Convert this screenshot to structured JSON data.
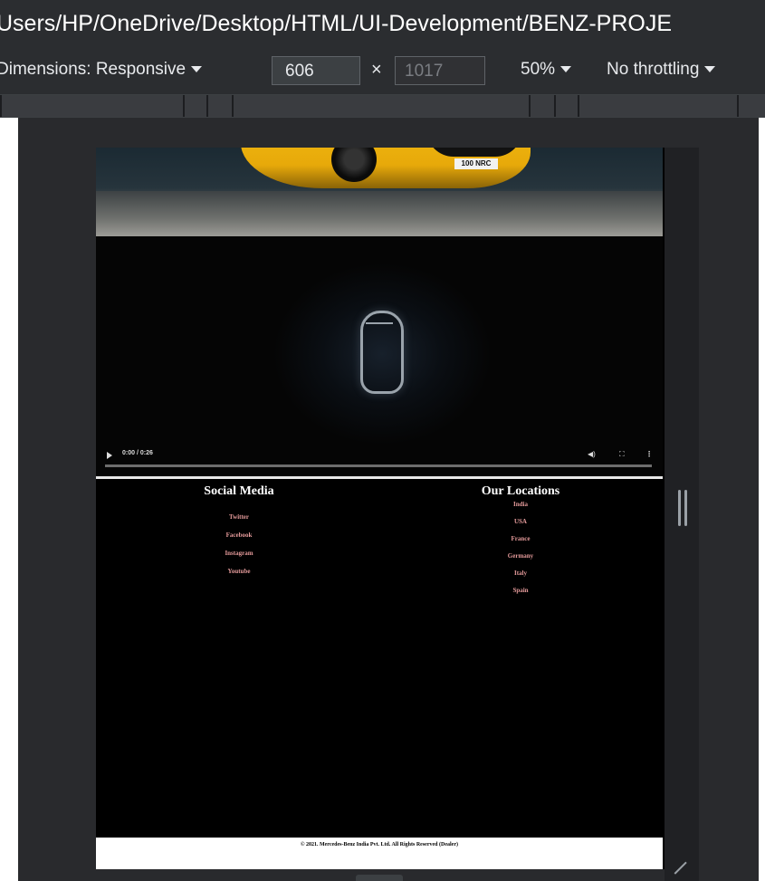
{
  "browser": {
    "path": "Users/HP/OneDrive/Desktop/HTML/UI-Development/BENZ-PROJE"
  },
  "device_toolbar": {
    "dimensions_label": "Dimensions: Responsive",
    "width_value": "606",
    "times": "×",
    "height_placeholder": "1017",
    "zoom": "50%",
    "throttling": "No throttling"
  },
  "page": {
    "hero": {
      "plate": "100 NRC"
    },
    "video": {
      "time": "0:00 / 0:26",
      "volume_icon": "volume-icon",
      "fullscreen_icon": "fullscreen-icon",
      "more_icon": "more-options-icon",
      "progress": 0
    },
    "footer": {
      "social_title": "Social Media",
      "social_links": [
        "Twitter",
        "Facebook",
        "Instagram",
        "Youtube"
      ],
      "locations_title": "Our Locations",
      "locations": [
        "India",
        "USA",
        "France",
        "Germany",
        "Italy",
        "Spain"
      ],
      "link_color": "#e49a9a"
    },
    "copyright": "© 2021. Mercedes-Benz India Pvt. Ltd. All Rights Reserved (Dealer)"
  }
}
